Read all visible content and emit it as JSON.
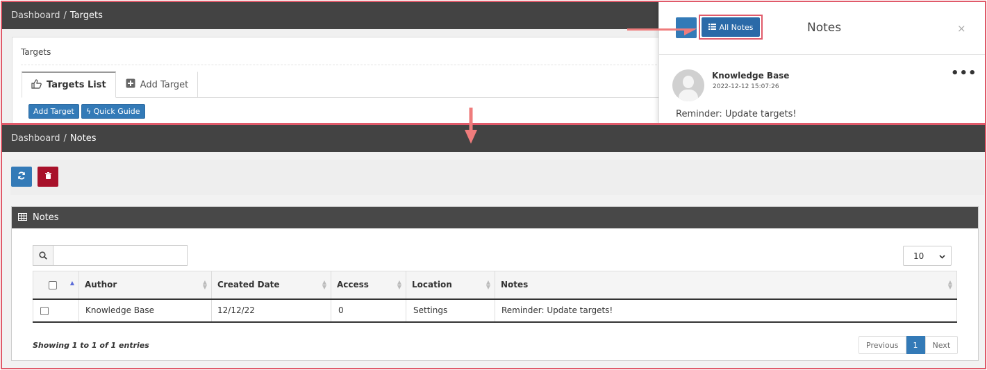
{
  "top": {
    "breadcrumb": {
      "home": "Dashboard",
      "sep": "/",
      "current": "Targets"
    },
    "card_title": "Targets",
    "tabs": [
      {
        "label": "Targets List"
      },
      {
        "label": "Add Target"
      }
    ],
    "buttons": {
      "add_target": "Add Target",
      "quick_guide": "Quick Guide"
    },
    "notes_panel": {
      "all_notes_label": "All Notes",
      "title": "Notes",
      "close": "×",
      "note": {
        "author": "Knowledge Base",
        "date": "2022-12-12 15:07:26",
        "menu": "•••",
        "text": "Reminder: Update targets!"
      }
    }
  },
  "bottom": {
    "breadcrumb": {
      "home": "Dashboard",
      "sep": "/",
      "current": "Notes"
    },
    "box_title": "Notes",
    "page_length": "10",
    "table": {
      "columns": [
        "",
        "Author",
        "Created Date",
        "Access",
        "Location",
        "Notes"
      ],
      "rows": [
        {
          "author": "Knowledge Base",
          "created": "12/12/22",
          "access": "0",
          "location": "Settings",
          "notes": "Reminder: Update targets!"
        }
      ]
    },
    "info": "Showing 1 to 1 of 1 entries",
    "pagination": {
      "prev": "Previous",
      "page": "1",
      "next": "Next"
    }
  },
  "colors": {
    "highlight": "#e05a6a",
    "primary": "#337ab7",
    "danger": "#a8112a",
    "header_dark": "#434343"
  },
  "icons": [
    "thumbs-up-icon",
    "plus-square-icon",
    "bolt-icon",
    "list-icon",
    "refresh-icon",
    "trash-icon",
    "table-icon",
    "search-icon",
    "chevron-down-icon",
    "user-avatar-icon"
  ]
}
